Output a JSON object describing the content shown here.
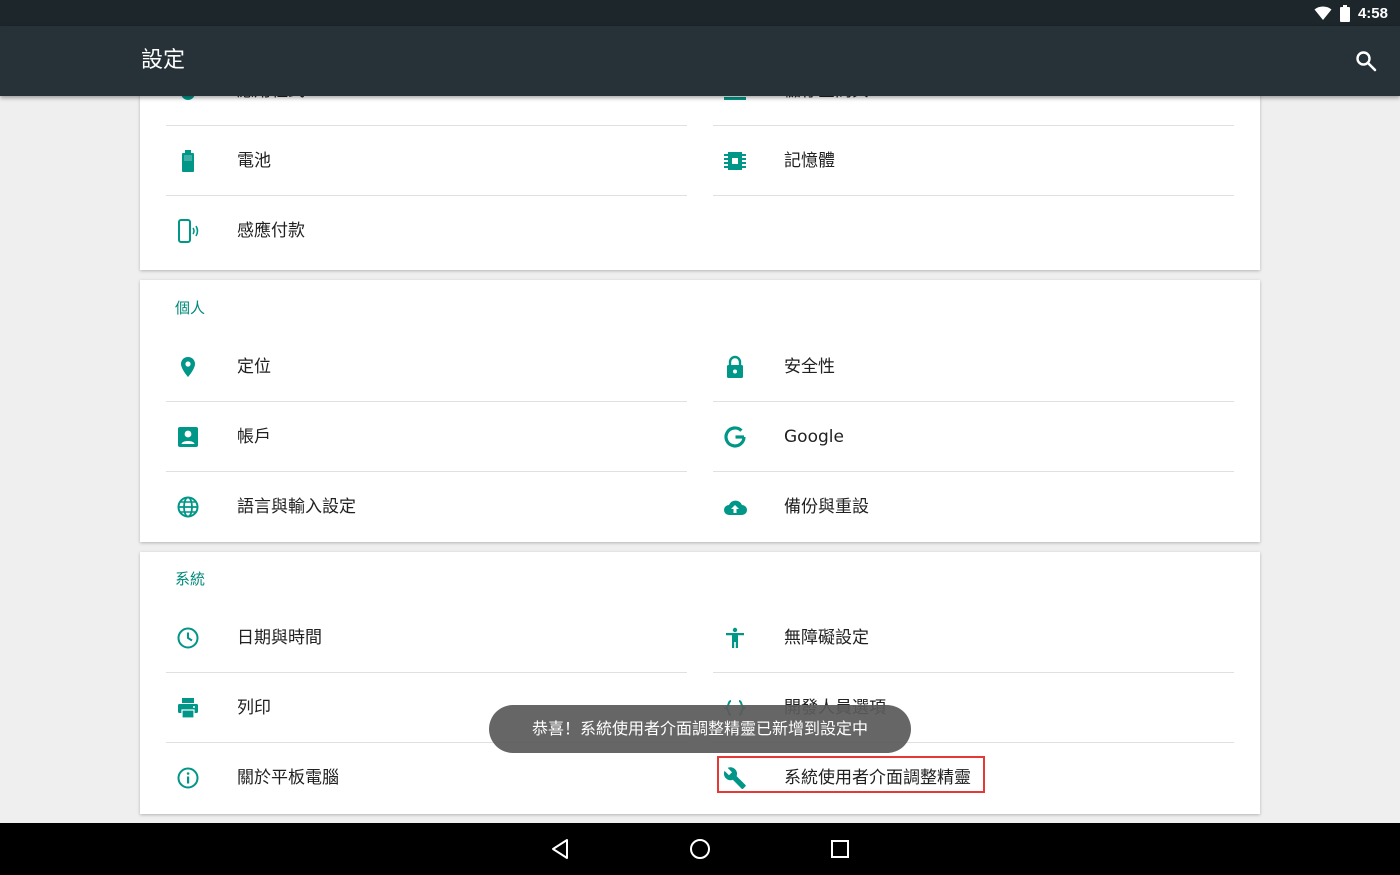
{
  "status_bar": {
    "time": "4:58",
    "icons": [
      "wifi-icon",
      "battery-icon"
    ]
  },
  "app_bar": {
    "title": "設定",
    "search_icon": "search-icon"
  },
  "colors": {
    "accent": "#009688",
    "app_bar": "#263238",
    "status_bar": "#1c262b",
    "highlight": "#e53935"
  },
  "device_section": {
    "items": [
      {
        "label": "應用程式",
        "icon": "apps-icon"
      },
      {
        "label": "儲存空間與 USB",
        "icon": "storage-icon"
      },
      {
        "label": "電池",
        "icon": "battery-icon"
      },
      {
        "label": "記憶體",
        "icon": "memory-icon"
      },
      {
        "label": "感應付款",
        "icon": "tap-pay-icon"
      }
    ]
  },
  "personal_section": {
    "title": "個人",
    "items": [
      {
        "label": "定位",
        "icon": "location-icon"
      },
      {
        "label": "安全性",
        "icon": "lock-icon"
      },
      {
        "label": "帳戶",
        "icon": "account-icon"
      },
      {
        "label": "Google",
        "icon": "google-icon"
      },
      {
        "label": "語言與輸入設定",
        "icon": "language-icon"
      },
      {
        "label": "備份與重設",
        "icon": "backup-icon"
      }
    ]
  },
  "system_section": {
    "title": "系統",
    "items": [
      {
        "label": "日期與時間",
        "icon": "clock-icon"
      },
      {
        "label": "無障礙設定",
        "icon": "accessibility-icon"
      },
      {
        "label": "列印",
        "icon": "print-icon"
      },
      {
        "label": "開發人員選項",
        "icon": "developer-icon"
      },
      {
        "label": "關於平板電腦",
        "icon": "info-icon"
      },
      {
        "label": "系統使用者介面調整精靈",
        "icon": "wrench-icon"
      }
    ]
  },
  "toast": {
    "message": "恭喜！系統使用者介面調整精靈已新增到設定中"
  },
  "nav_bar": {
    "buttons": [
      "back-icon",
      "home-icon",
      "recents-icon"
    ]
  }
}
